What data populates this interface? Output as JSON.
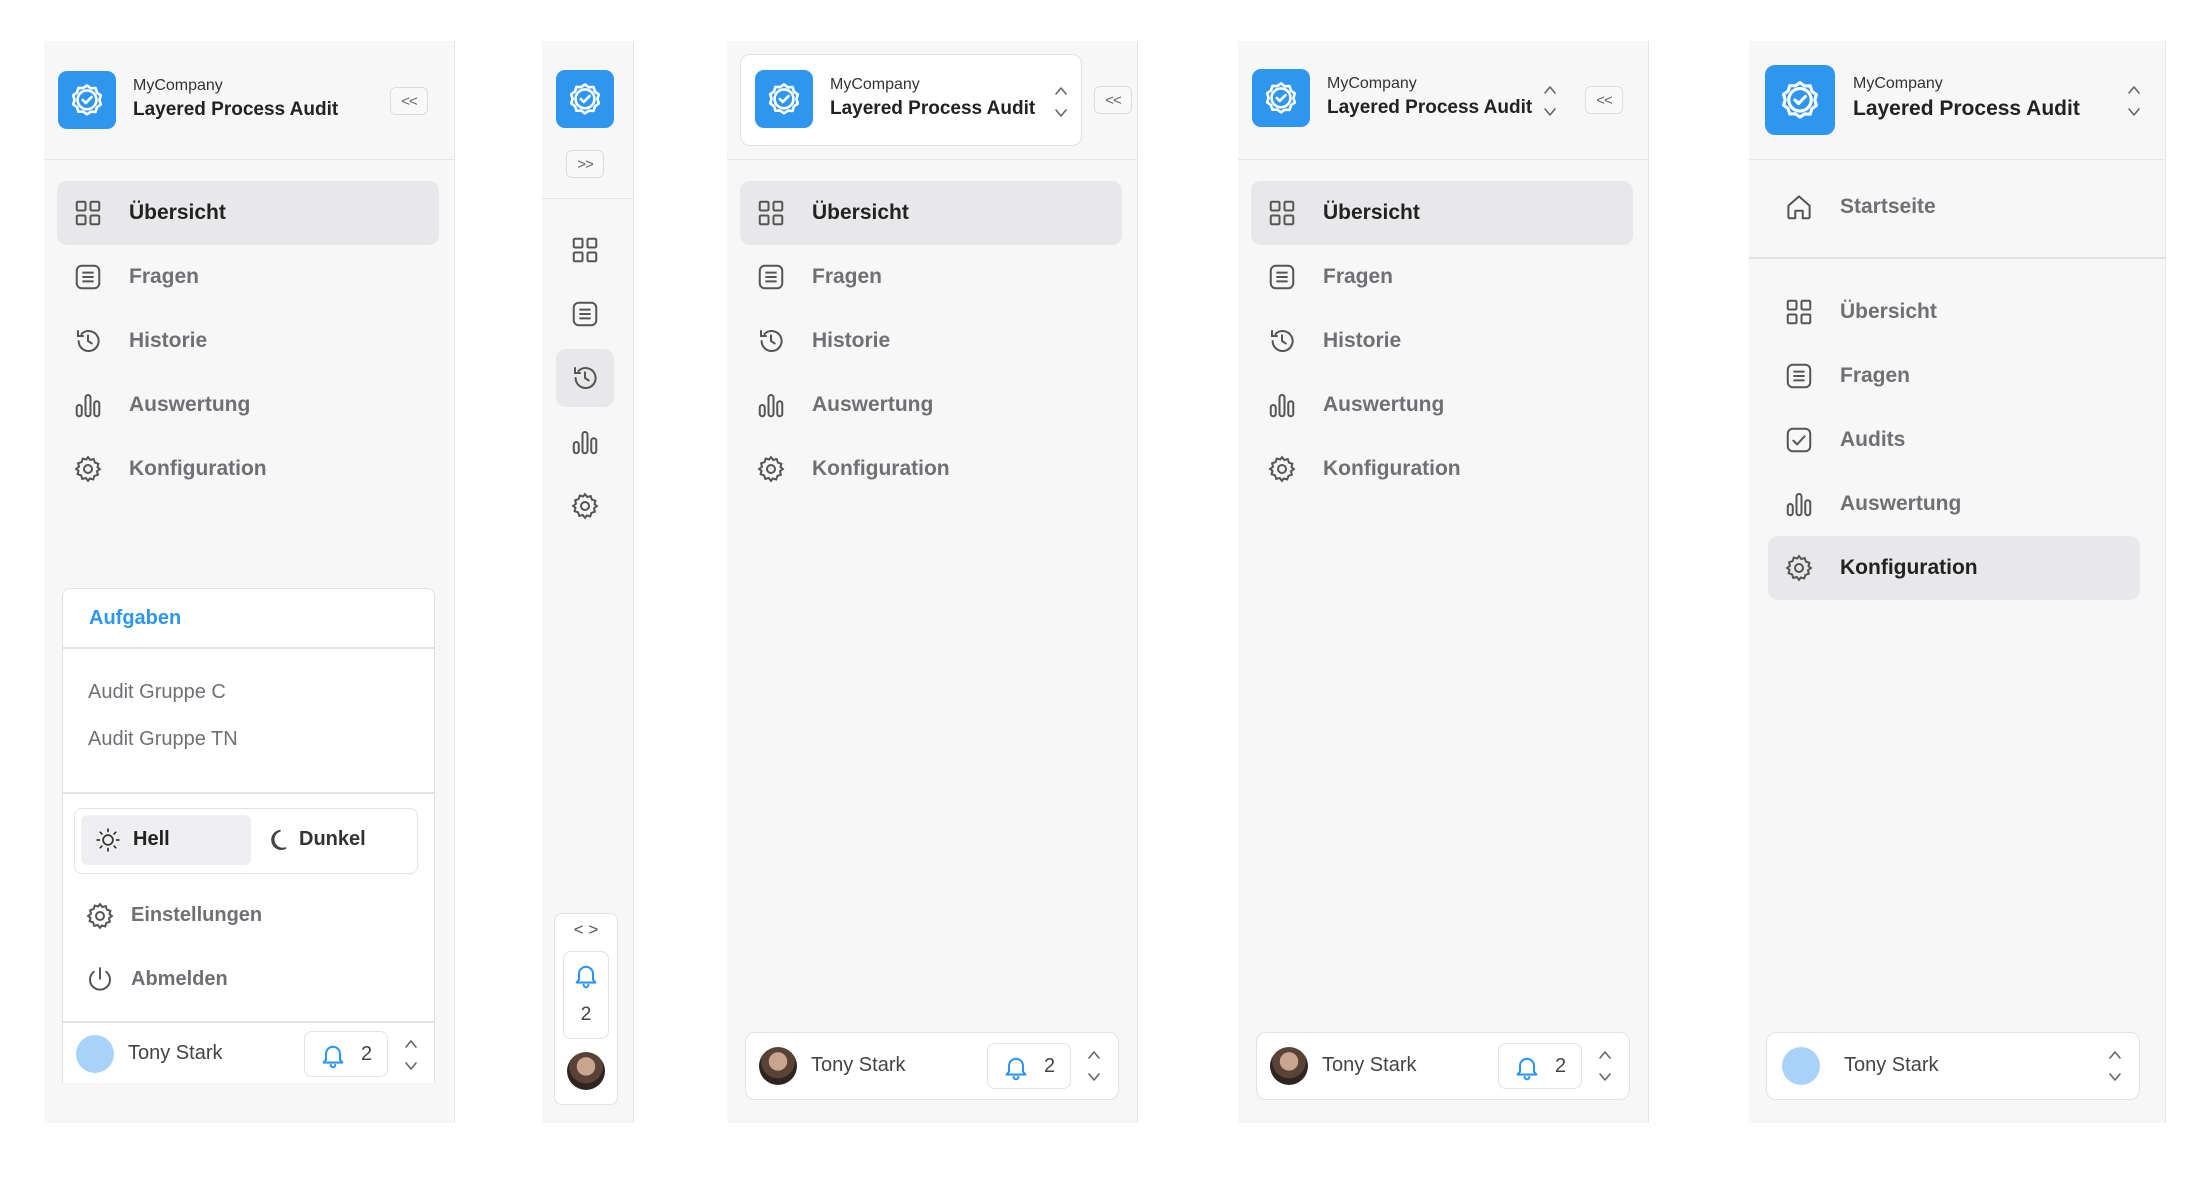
{
  "brand": {
    "company": "MyCompany",
    "app_name": "Layered Process Audit",
    "accent": "#2f96f0"
  },
  "nav": [
    {
      "label": "Übersicht",
      "icon": "grid-icon"
    },
    {
      "label": "Fragen",
      "icon": "list-icon"
    },
    {
      "label": "Historie",
      "icon": "history-icon"
    },
    {
      "label": "Auswertung",
      "icon": "bar-chart-icon"
    },
    {
      "label": "Konfiguration",
      "icon": "gear-icon"
    }
  ],
  "nav_extended": [
    {
      "label": "Startseite",
      "icon": "home-icon"
    },
    {
      "label": "Übersicht",
      "icon": "grid-icon"
    },
    {
      "label": "Fragen",
      "icon": "list-icon"
    },
    {
      "label": "Audits",
      "icon": "check-square-icon"
    },
    {
      "label": "Auswertung",
      "icon": "bar-chart-icon"
    },
    {
      "label": "Konfiguration",
      "icon": "gear-icon"
    }
  ],
  "collapse_label": "<<",
  "expand_label": ">>",
  "code_label": "< >",
  "user_menu": {
    "tasks_title": "Aufgaben",
    "tasks": [
      "Audit Gruppe C",
      "Audit Gruppe TN"
    ],
    "theme_light": "Hell",
    "theme_dark": "Dunkel",
    "settings": "Einstellungen",
    "logout": "Abmelden"
  },
  "user": {
    "name": "Tony Stark",
    "notifications": "2"
  }
}
